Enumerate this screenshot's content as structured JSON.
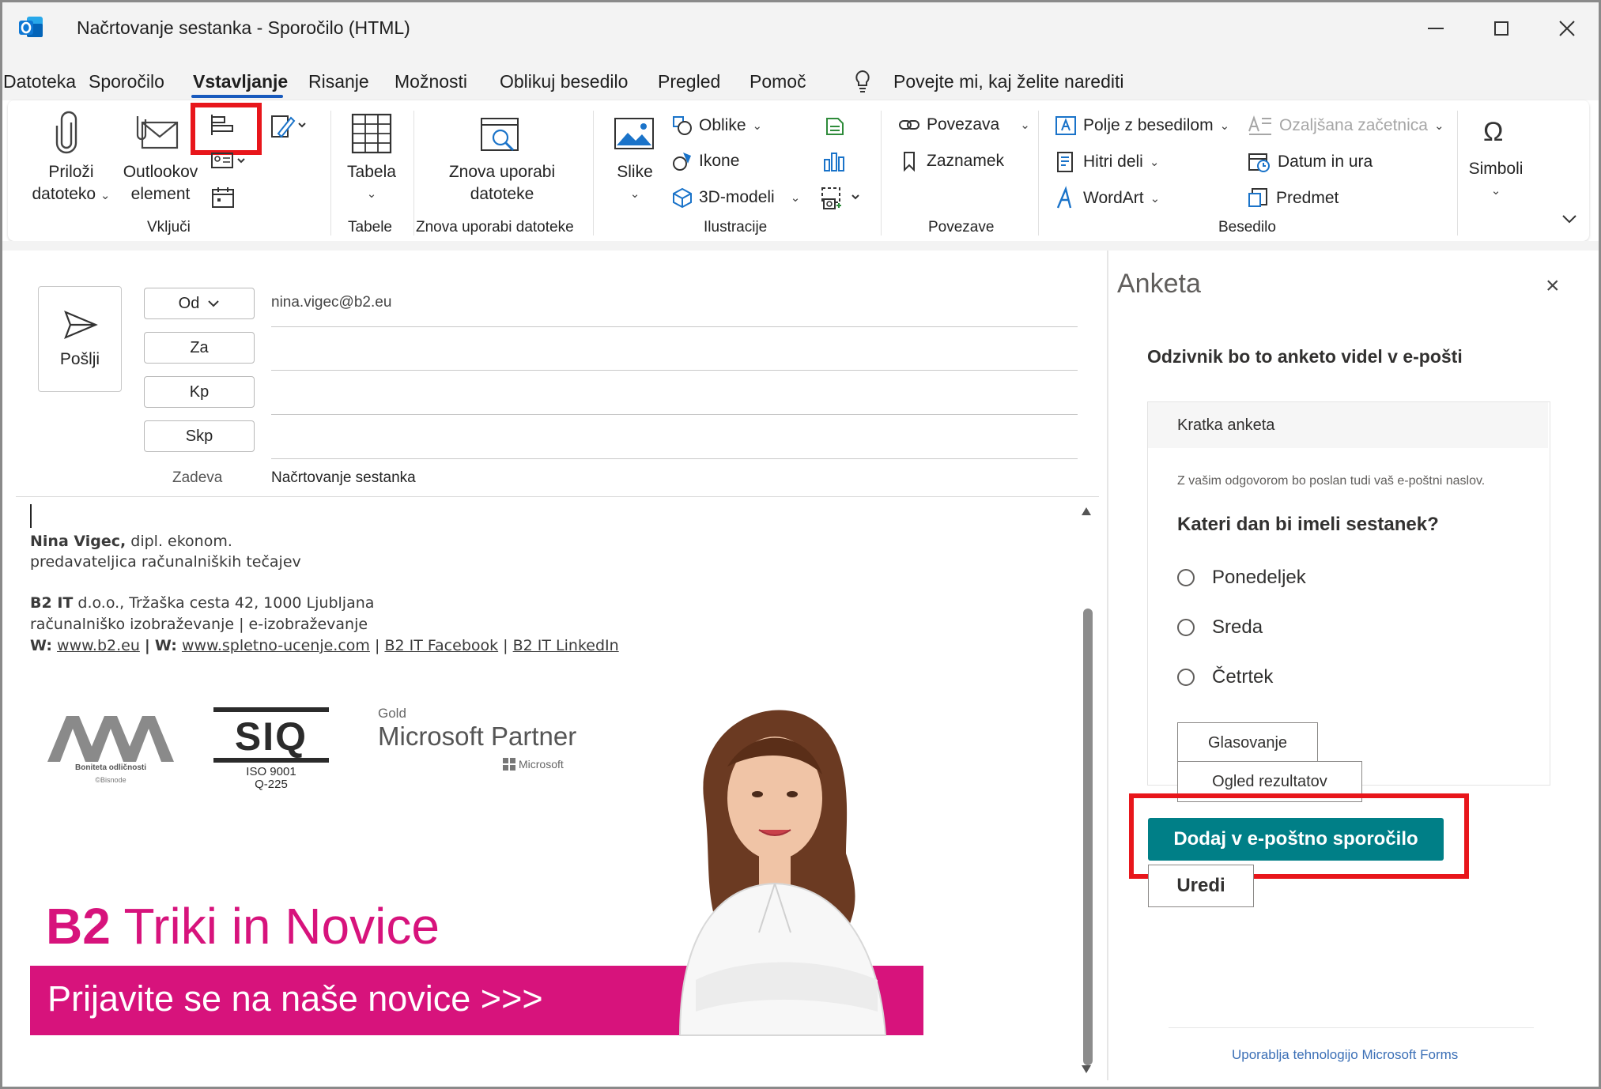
{
  "window": {
    "title": "Načrtovanje sestanka  -  Sporočilo (HTML)"
  },
  "menu": {
    "items": [
      "Datoteka",
      "Sporočilo",
      "Vstavljanje",
      "Risanje",
      "Možnosti",
      "Oblikuj besedilo",
      "Pregled",
      "Pomoč"
    ],
    "active": "Vstavljanje",
    "tell_me": "Povejte mi, kaj želite narediti"
  },
  "ribbon": {
    "attach_line1": "Priloži",
    "attach_line2": "datoteko",
    "outlook_line1": "Outlookov",
    "outlook_line2": "element",
    "group_include": "Vključi",
    "table_label": "Tabela",
    "group_tables": "Tabele",
    "reuse_line1": "Znova uporabi",
    "reuse_line2": "datoteke",
    "group_reuse": "Znova uporabi datoteke",
    "pictures": "Slike",
    "shapes": "Oblike",
    "icons": "Ikone",
    "models3d": "3D-modeli",
    "group_illustrations": "Ilustracije",
    "link": "Povezava",
    "bookmark": "Zaznamek",
    "group_links": "Povezave",
    "textbox": "Polje z besedilom",
    "quickparts": "Hitri deli",
    "wordart": "WordArt",
    "dropcap": "Ozaljšana začetnica",
    "datetime": "Datum in ura",
    "object": "Predmet",
    "group_text": "Besedilo",
    "symbols": "Simboli"
  },
  "compose": {
    "send": "Pošlji",
    "from_btn": "Od",
    "from_value": "nina.vigec@b2.eu",
    "to_btn": "Za",
    "cc_btn": "Kp",
    "bcc_btn": "Skp",
    "subject_label": "Zadeva",
    "subject_value": "Načrtovanje sestanka"
  },
  "signature": {
    "name": "Nina Vigec,",
    "title": " dipl. ekonom.",
    "role": "predavateljica računalniških tečajev",
    "company": "B2 IT",
    "address": " d.o.o., Tržaška cesta 42, 1000 Ljubljana",
    "services": "računalniško izobraževanje | e-izobraževanje",
    "w_label": "W:",
    "web1": "www.b2.eu",
    "web2": "www.spletno-ucenje.com",
    "facebook": "B2 IT Facebook",
    "linkedin": "B2 IT LinkedIn",
    "sep": "|"
  },
  "logos": {
    "aaa": "AAA",
    "aaa_caption": "Boniteta odličnosti",
    "aaa_caption2": "©Bisnode",
    "siq": "SIQ",
    "iso_line1": "ISO 9001",
    "iso_line2": "Q-225",
    "ms_gold": "Gold",
    "ms_partner": "Microsoft Partner",
    "ms_small": "Microsoft"
  },
  "banner": {
    "b2": "B2",
    "title_rest": " Triki in Novice",
    "cta": "Prijavite se na naše novice  >>>",
    "pink": "#d7137c"
  },
  "panel": {
    "title": "Anketa",
    "subtitle": "Odzivnik bo to anketo videl v e-pošti",
    "card_title": "Kratka anketa",
    "note": "Z vašim odgovorom bo poslan tudi vaš e-poštni naslov.",
    "question": "Kateri dan bi imeli sestanek?",
    "options": [
      "Ponedeljek",
      "Sreda",
      "Četrtek"
    ],
    "vote_btn": "Glasovanje",
    "results_btn": "Ogled rezultatov",
    "add_btn": "Dodaj v e-poštno sporočilo",
    "edit_btn": "Uredi",
    "footer": "Uporablja tehnologijo Microsoft Forms",
    "accent": "#007f87"
  },
  "highlight_color": "#e8161b"
}
